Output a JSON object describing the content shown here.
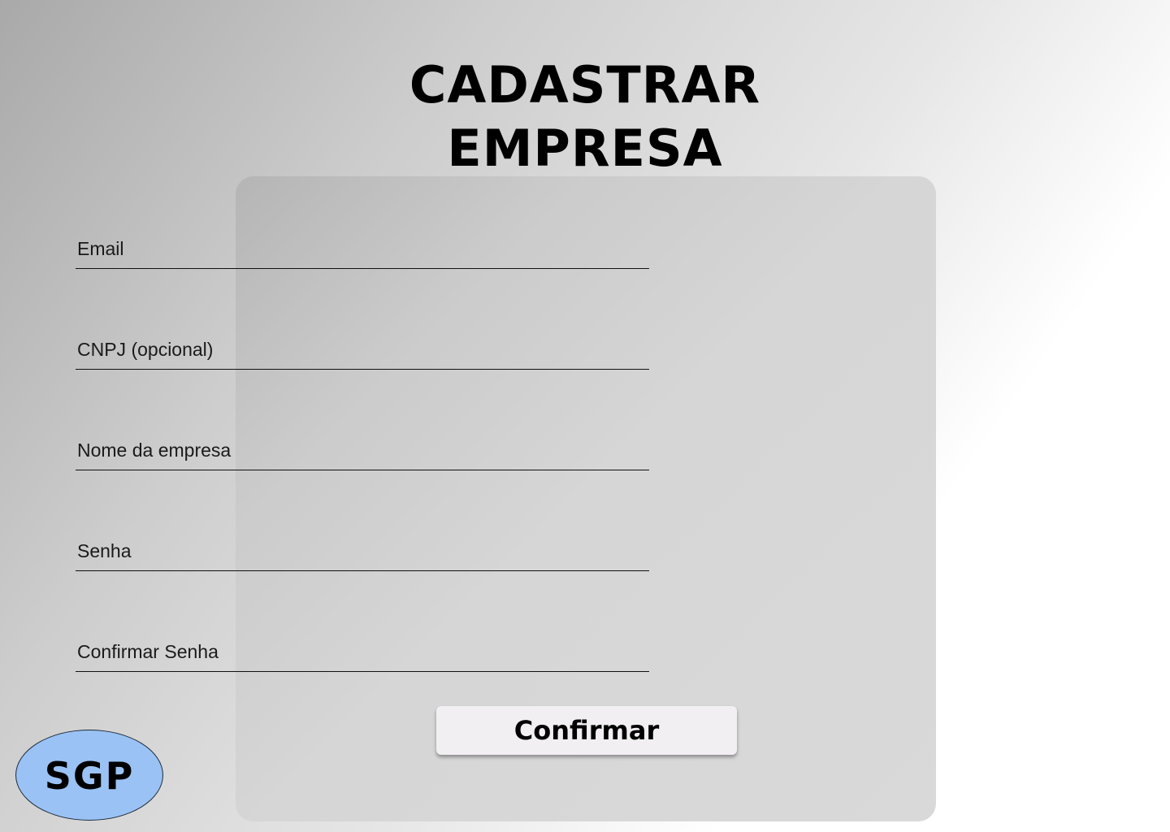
{
  "header": {
    "title_line1": "CADASTRAR",
    "title_line2": "EMPRESA"
  },
  "form": {
    "fields": [
      {
        "placeholder": "Email",
        "value": ""
      },
      {
        "placeholder": "CNPJ (opcional)",
        "value": ""
      },
      {
        "placeholder": "Nome da empresa",
        "value": ""
      },
      {
        "placeholder": "Senha",
        "value": ""
      },
      {
        "placeholder": "Confirmar Senha",
        "value": ""
      }
    ],
    "submit_label": "Confirmar"
  },
  "logo": {
    "text": "SGP",
    "color": "#9ac2f4"
  }
}
